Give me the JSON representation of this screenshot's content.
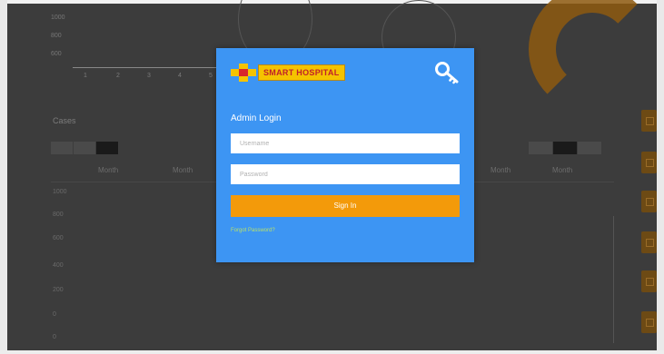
{
  "background": {
    "chart_y_ticks": [
      "1000",
      "800",
      "600"
    ],
    "chart_x_ticks": [
      "1",
      "2",
      "3",
      "4",
      "5"
    ],
    "section_label": "Cases",
    "left_tabs": [
      "",
      "",
      ""
    ],
    "right_tabs": [
      "",
      "",
      ""
    ],
    "table_columns": [
      "Month",
      "Month",
      "Month",
      "Month"
    ],
    "row_labels": [
      "1000",
      "800",
      "600",
      "400",
      "200",
      "0",
      "0"
    ]
  },
  "modal": {
    "logo_text": "SMART HOSPITAL",
    "icons": {
      "logo": "hospital-cross-icon",
      "key": "key-icon"
    },
    "title": "Admin Login",
    "username_placeholder": "Username",
    "password_placeholder": "Password",
    "signin_label": "Sign In",
    "forgot_label": "Forgot Password?"
  },
  "colors": {
    "modal_bg": "#3d95f3",
    "button_bg": "#f39a0a",
    "logo_bg": "#f5c300",
    "logo_cross_red": "#d8252c",
    "forgot_link": "#b8e06a"
  }
}
